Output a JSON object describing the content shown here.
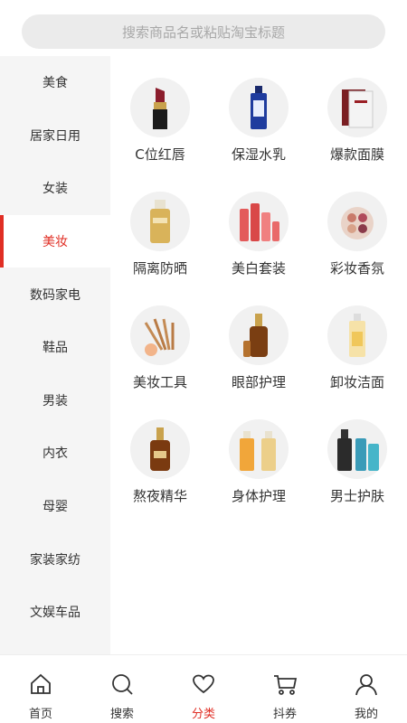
{
  "search": {
    "placeholder": "搜索商品名或粘贴淘宝标题"
  },
  "sidebar": {
    "items": [
      {
        "label": "美食"
      },
      {
        "label": "居家日用"
      },
      {
        "label": "女装"
      },
      {
        "label": "美妆",
        "active": true
      },
      {
        "label": "数码家电"
      },
      {
        "label": "鞋品"
      },
      {
        "label": "男装"
      },
      {
        "label": "内衣"
      },
      {
        "label": "母婴"
      },
      {
        "label": "家装家纺"
      },
      {
        "label": "文娱车品"
      }
    ]
  },
  "categories": [
    {
      "label": "C位红唇",
      "icon": "lipstick-icon"
    },
    {
      "label": "保湿水乳",
      "icon": "lotion-bottle-icon"
    },
    {
      "label": "爆款面膜",
      "icon": "face-mask-icon"
    },
    {
      "label": "隔离防晒",
      "icon": "sunscreen-icon"
    },
    {
      "label": "美白套装",
      "icon": "whitening-set-icon"
    },
    {
      "label": "彩妆香氛",
      "icon": "makeup-palette-icon"
    },
    {
      "label": "美妆工具",
      "icon": "makeup-brushes-icon"
    },
    {
      "label": "眼部护理",
      "icon": "eye-serum-icon"
    },
    {
      "label": "卸妆洁面",
      "icon": "cleanser-bottle-icon"
    },
    {
      "label": "熬夜精华",
      "icon": "serum-bottle-icon"
    },
    {
      "label": "身体护理",
      "icon": "body-lotion-icon"
    },
    {
      "label": "男士护肤",
      "icon": "mens-skincare-icon"
    }
  ],
  "tabbar": {
    "tabs": [
      {
        "label": "首页",
        "icon": "home-icon"
      },
      {
        "label": "搜索",
        "icon": "search-icon"
      },
      {
        "label": "分类",
        "icon": "heart-icon",
        "active": true
      },
      {
        "label": "抖券",
        "icon": "cart-icon"
      },
      {
        "label": "我的",
        "icon": "user-icon"
      }
    ]
  },
  "colors": {
    "accent": "#e02e24",
    "sidebar_bg": "#f5f5f5",
    "search_bg": "#ebebeb"
  }
}
